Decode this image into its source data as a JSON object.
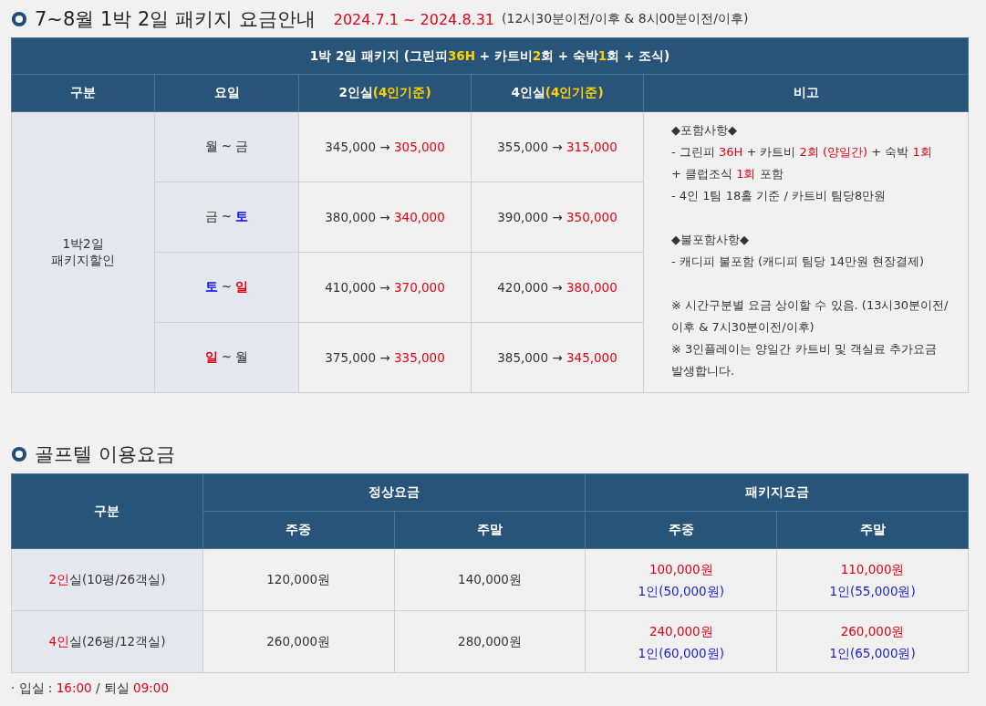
{
  "package_section": {
    "title": "7~8월 1박 2일 패키지 요금안내",
    "period": "2024.7.1 ~ 2024.8.31",
    "hours": "(12시30분이전/이후 & 8시00분이전/이후)",
    "table": {
      "caption": [
        {
          "text": "1박 2일 패키지 (그린피"
        },
        {
          "text": "36H",
          "color": "#ffd200"
        },
        {
          "text": " + 카트비"
        },
        {
          "text": "2",
          "color": "#ffd200"
        },
        {
          "text": "회 + 숙박"
        },
        {
          "text": "1",
          "color": "#ffd200"
        },
        {
          "text": "회 + 조식)"
        }
      ],
      "columns": [
        [
          {
            "text": "구분"
          }
        ],
        [
          {
            "text": "요일"
          }
        ],
        [
          {
            "text": "2인실"
          },
          {
            "text": "(4인기준)",
            "color": "#ffd200"
          }
        ],
        [
          {
            "text": "4인실"
          },
          {
            "text": "(4인기준)",
            "color": "#ffd200"
          }
        ],
        [
          {
            "text": "비고"
          }
        ]
      ],
      "category": [
        "1박2일",
        "패키지할인"
      ],
      "rows": [
        {
          "day": [
            {
              "text": "월 ~ 금"
            }
          ],
          "two_person": [
            {
              "text": "345,000 → "
            },
            {
              "text": "305,000",
              "color": "#e60012"
            }
          ],
          "four_person": [
            {
              "text": "355,000 → "
            },
            {
              "text": "315,000",
              "color": "#e60012"
            }
          ]
        },
        {
          "day": [
            {
              "text": "금 ~ "
            },
            {
              "text": "토",
              "color": "#0000ff"
            }
          ],
          "two_person": [
            {
              "text": "380,000 → "
            },
            {
              "text": "340,000",
              "color": "#e60012"
            }
          ],
          "four_person": [
            {
              "text": "390,000 → "
            },
            {
              "text": "350,000",
              "color": "#e60012"
            }
          ]
        },
        {
          "day": [
            {
              "text": "토",
              "color": "#0000ff"
            },
            {
              "text": " ~ "
            },
            {
              "text": "일",
              "color": "#e60012"
            }
          ],
          "two_person": [
            {
              "text": "410,000 → "
            },
            {
              "text": "370,000",
              "color": "#e60012"
            }
          ],
          "four_person": [
            {
              "text": "420,000 → "
            },
            {
              "text": "380,000",
              "color": "#e60012"
            }
          ]
        },
        {
          "day": [
            {
              "text": "일",
              "color": "#e60012"
            },
            {
              "text": " ~ 월"
            }
          ],
          "two_person": [
            {
              "text": "375,000 → "
            },
            {
              "text": "335,000",
              "color": "#e60012"
            }
          ],
          "four_person": [
            {
              "text": "385,000 → "
            },
            {
              "text": "345,000",
              "color": "#e60012"
            }
          ]
        }
      ],
      "notes": [
        [
          [
            {
              "text": "◆포함사항◆"
            }
          ],
          [
            {
              "text": "- 그린피 "
            },
            {
              "text": "36H",
              "color": "#e60012"
            },
            {
              "text": " + 카트비 "
            },
            {
              "text": "2회 (양일간)",
              "color": "#e60012"
            },
            {
              "text": " + 숙박 "
            },
            {
              "text": "1회",
              "color": "#e60012"
            }
          ],
          [
            {
              "text": "+ 클럽조식 "
            },
            {
              "text": "1회",
              "color": "#e60012"
            },
            {
              "text": " 포함"
            }
          ],
          [
            {
              "text": "- 4인 1팀 18홀 기준 / 카트비 팀당8만원"
            }
          ]
        ],
        [
          [
            {
              "text": "◆불포함사항◆"
            }
          ],
          [
            {
              "text": "- 캐디피 불포함 (캐디피 팀당 14만원 현장결제)"
            }
          ]
        ],
        [
          [
            {
              "text": "※ 시간구분별 요금 상이할 수 있음. (13시30분이전/이후 & 7시30분이전/이후)"
            }
          ],
          [
            {
              "text": "※ 3인플레이는 양일간 카트비 및 객실료 추가요금 발생합니다."
            }
          ]
        ]
      ]
    }
  },
  "golftel_section": {
    "title": "골프텔 이용요금",
    "table": {
      "category_header": "구분",
      "group_headers": [
        "정상요금",
        "패키지요금"
      ],
      "sub_headers": [
        "주중",
        "주말",
        "주중",
        "주말"
      ],
      "rows": [
        {
          "room": [
            {
              "text": "2인",
              "color": "#e60012"
            },
            {
              "text": "실(10평/26객실)"
            }
          ],
          "normal": [
            "120,000원",
            "140,000원"
          ],
          "package": [
            {
              "price": "100,000원",
              "per_person": "1인(50,000원)"
            },
            {
              "price": "110,000원",
              "per_person": "1인(55,000원)"
            }
          ]
        },
        {
          "room": [
            {
              "text": "4인",
              "color": "#e60012"
            },
            {
              "text": "실(26평/12객실)"
            }
          ],
          "normal": [
            "260,000원",
            "280,000원"
          ],
          "package": [
            {
              "price": "240,000원",
              "per_person": "1인(60,000원)"
            },
            {
              "price": "260,000원",
              "per_person": "1인(65,000원)"
            }
          ]
        }
      ]
    },
    "footer": [
      {
        "text": "· 입실 : "
      },
      {
        "text": "16:00",
        "color": "#e60012"
      },
      {
        "text": " / 퇴실 "
      },
      {
        "text": "09:00",
        "color": "#e60012"
      }
    ]
  }
}
